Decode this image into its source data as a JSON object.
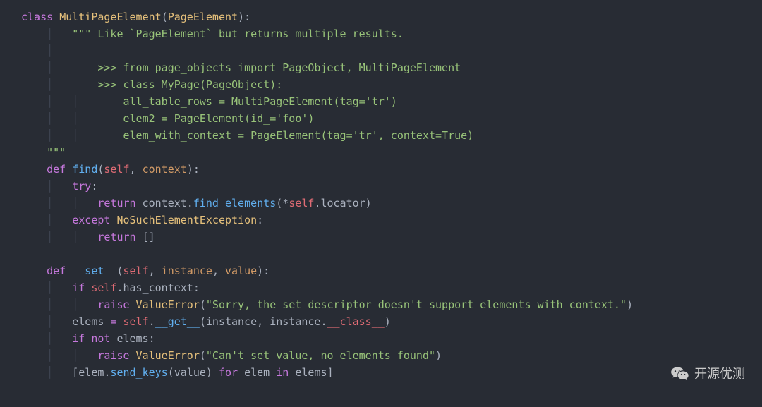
{
  "code": {
    "line0": {
      "kw_class": "class",
      "cls": "MultiPageElement",
      "paren_o": "(",
      "parent": "PageElement",
      "paren_c": "):"
    },
    "line1": {
      "q": "\"\"\" ",
      "text": "Like `PageElement` but returns multiple results."
    },
    "line3": {
      "text": ">>> from page_objects import PageObject, MultiPageElement"
    },
    "line4": {
      "text": ">>> class MyPage(PageObject):"
    },
    "line5": {
      "text": "all_table_rows = MultiPageElement(tag='tr')"
    },
    "line6": {
      "text": "elem2 = PageElement(id_='foo')"
    },
    "line7": {
      "text": "elem_with_context = PageElement(tag='tr', context=True)"
    },
    "line8": {
      "q": "\"\"\""
    },
    "line9": {
      "kw_def": "def",
      "fn": "find",
      "paren_o": "(",
      "self": "self",
      "comma": ", ",
      "p1": "context",
      "paren_c": "):"
    },
    "line10": {
      "try": "try",
      "colon": ":"
    },
    "line11": {
      "ret": "return",
      "ctx": " context.",
      "call": "find_elements",
      "po": "(*",
      "self": "self",
      "dot": ".locator)"
    },
    "line12": {
      "exc": "except",
      "cls": " NoSuchElementException",
      "colon": ":"
    },
    "line13": {
      "ret": "return",
      "val": " []"
    },
    "line15": {
      "kw_def": "def",
      "fn": "__set__",
      "paren_o": "(",
      "self": "self",
      "c1": ", ",
      "p1": "instance",
      "c2": ", ",
      "p2": "value",
      "paren_c": "):"
    },
    "line16": {
      "if": "if",
      "self": " self",
      "attr": ".has_context:"
    },
    "line17": {
      "raise": "raise",
      "cls": " ValueError",
      "po": "(",
      "str": "\"Sorry, the set descriptor doesn't support elements with context.\"",
      "pc": ")"
    },
    "line18": {
      "var": "elems ",
      "eq": "=",
      "self": " self",
      "dot": ".",
      "fn": "__get__",
      "po": "(instance, instance.",
      "dunder": "__class__",
      "pc": ")"
    },
    "line19": {
      "if": "if",
      "not": " not",
      "var": " elems:"
    },
    "line20": {
      "raise": "raise",
      "cls": " ValueError",
      "po": "(",
      "str": "\"Can't set value, no elements found\"",
      "pc": ")"
    },
    "line21": {
      "bo": "[elem.",
      "fn": "send_keys",
      "args": "(value) ",
      "for": "for",
      "mid": " elem ",
      "in": "in",
      "end": " elems]"
    }
  },
  "watermark": {
    "text": "开源优测"
  }
}
